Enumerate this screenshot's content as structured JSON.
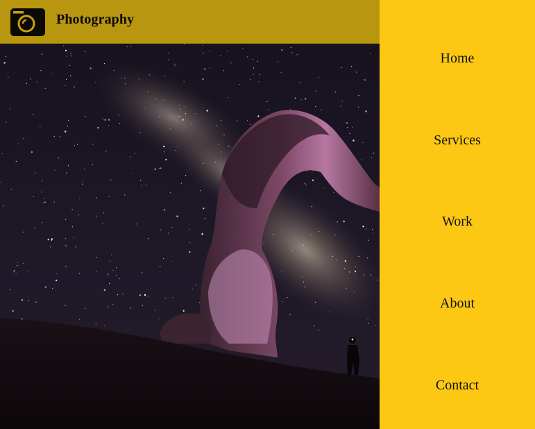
{
  "header": {
    "brand": "Photography",
    "logo_icon": "camera-icon"
  },
  "nav": {
    "items": [
      {
        "label": "Home"
      },
      {
        "label": "Services"
      },
      {
        "label": "Work"
      },
      {
        "label": "About"
      },
      {
        "label": "Contact"
      }
    ]
  },
  "colors": {
    "nav_background": "#fcc814",
    "header_background": "#c6a00e",
    "sky": "#1c1624",
    "arch_highlight": "#c07ab0"
  },
  "hero": {
    "subject": "night-sky-with-milky-way-and-rock-arch"
  }
}
